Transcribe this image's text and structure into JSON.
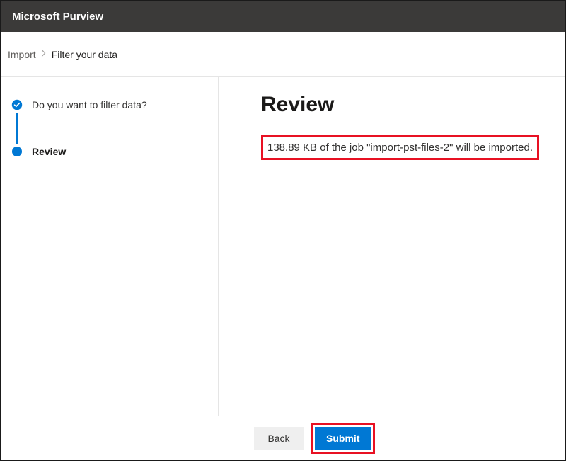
{
  "header": {
    "app_title": "Microsoft Purview"
  },
  "breadcrumb": {
    "parent": "Import",
    "current": "Filter your data"
  },
  "stepper": {
    "steps": [
      {
        "state": "done",
        "label": "Do you want to filter data?"
      },
      {
        "state": "current",
        "label": "Review"
      }
    ]
  },
  "main": {
    "title": "Review",
    "summary": "138.89 KB of the job \"import-pst-files-2\" will be imported."
  },
  "footer": {
    "back_label": "Back",
    "submit_label": "Submit"
  }
}
